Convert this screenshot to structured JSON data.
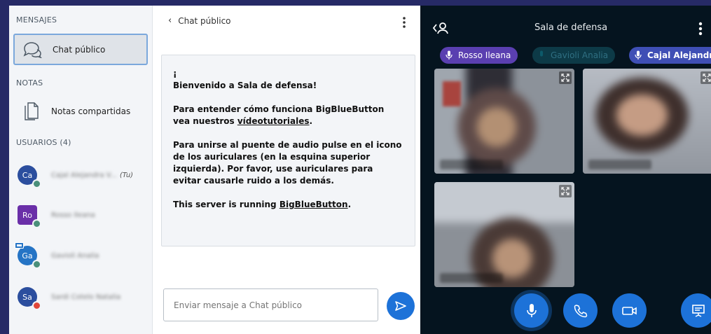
{
  "sidebar": {
    "messages_title": "MENSAJES",
    "public_chat_label": "Chat público",
    "notes_title": "NOTAS",
    "shared_notes_label": "Notas compartidas",
    "users_title": "USUARIOS (4)",
    "users": [
      {
        "initials": "Ca",
        "name": "Cajal Alejandra V...",
        "you_tag": "(Tu)",
        "color": "#2b4e9e",
        "badge_color": "#4a8f7a"
      },
      {
        "initials": "Ro",
        "name": "Rosso Ileana",
        "color": "#6a2fa8",
        "badge_color": "#4a8f7a"
      },
      {
        "initials": "Ga",
        "name": "Gavioli Analia",
        "color": "#2574c5",
        "badge_color": "#4a8f7a"
      },
      {
        "initials": "Sa",
        "name": "Sardi Cotelo Natalia",
        "color": "#2b4e9e",
        "badge_color": "#e0473a"
      }
    ]
  },
  "chat": {
    "header_title": "Chat público",
    "welcome": {
      "line1": "¡",
      "line2": "Bienvenido a Sala de defensa!",
      "p2_prefix": "Para entender cómo funciona BigBlueButton vea nuestros ",
      "p2_link": "vídeotutoriales",
      "p2_suffix": ".",
      "p3": "Para unirse al puente de audio pulse en el icono de los auriculares (en la esquina superior izquierda). Por favor, use auriculares para evitar causarle ruido a los demás.",
      "p4_prefix": "This server is running ",
      "p4_link": "BigBlueButton",
      "p4_suffix": "."
    },
    "input_placeholder": "Enviar mensaje a Chat público"
  },
  "video": {
    "room_title": "Sala de defensa",
    "talkers": [
      {
        "name": "Rosso Ileana",
        "color": "#5a3fb0"
      },
      {
        "name": "Gavioli Analia",
        "color": "#0d3a47"
      },
      {
        "name": "Cajal Alejandra",
        "color": "#3f4fb5"
      }
    ]
  },
  "colors": {
    "accent": "#1d72d8",
    "frame_bg": "#262a66",
    "video_bg": "#05141f"
  }
}
